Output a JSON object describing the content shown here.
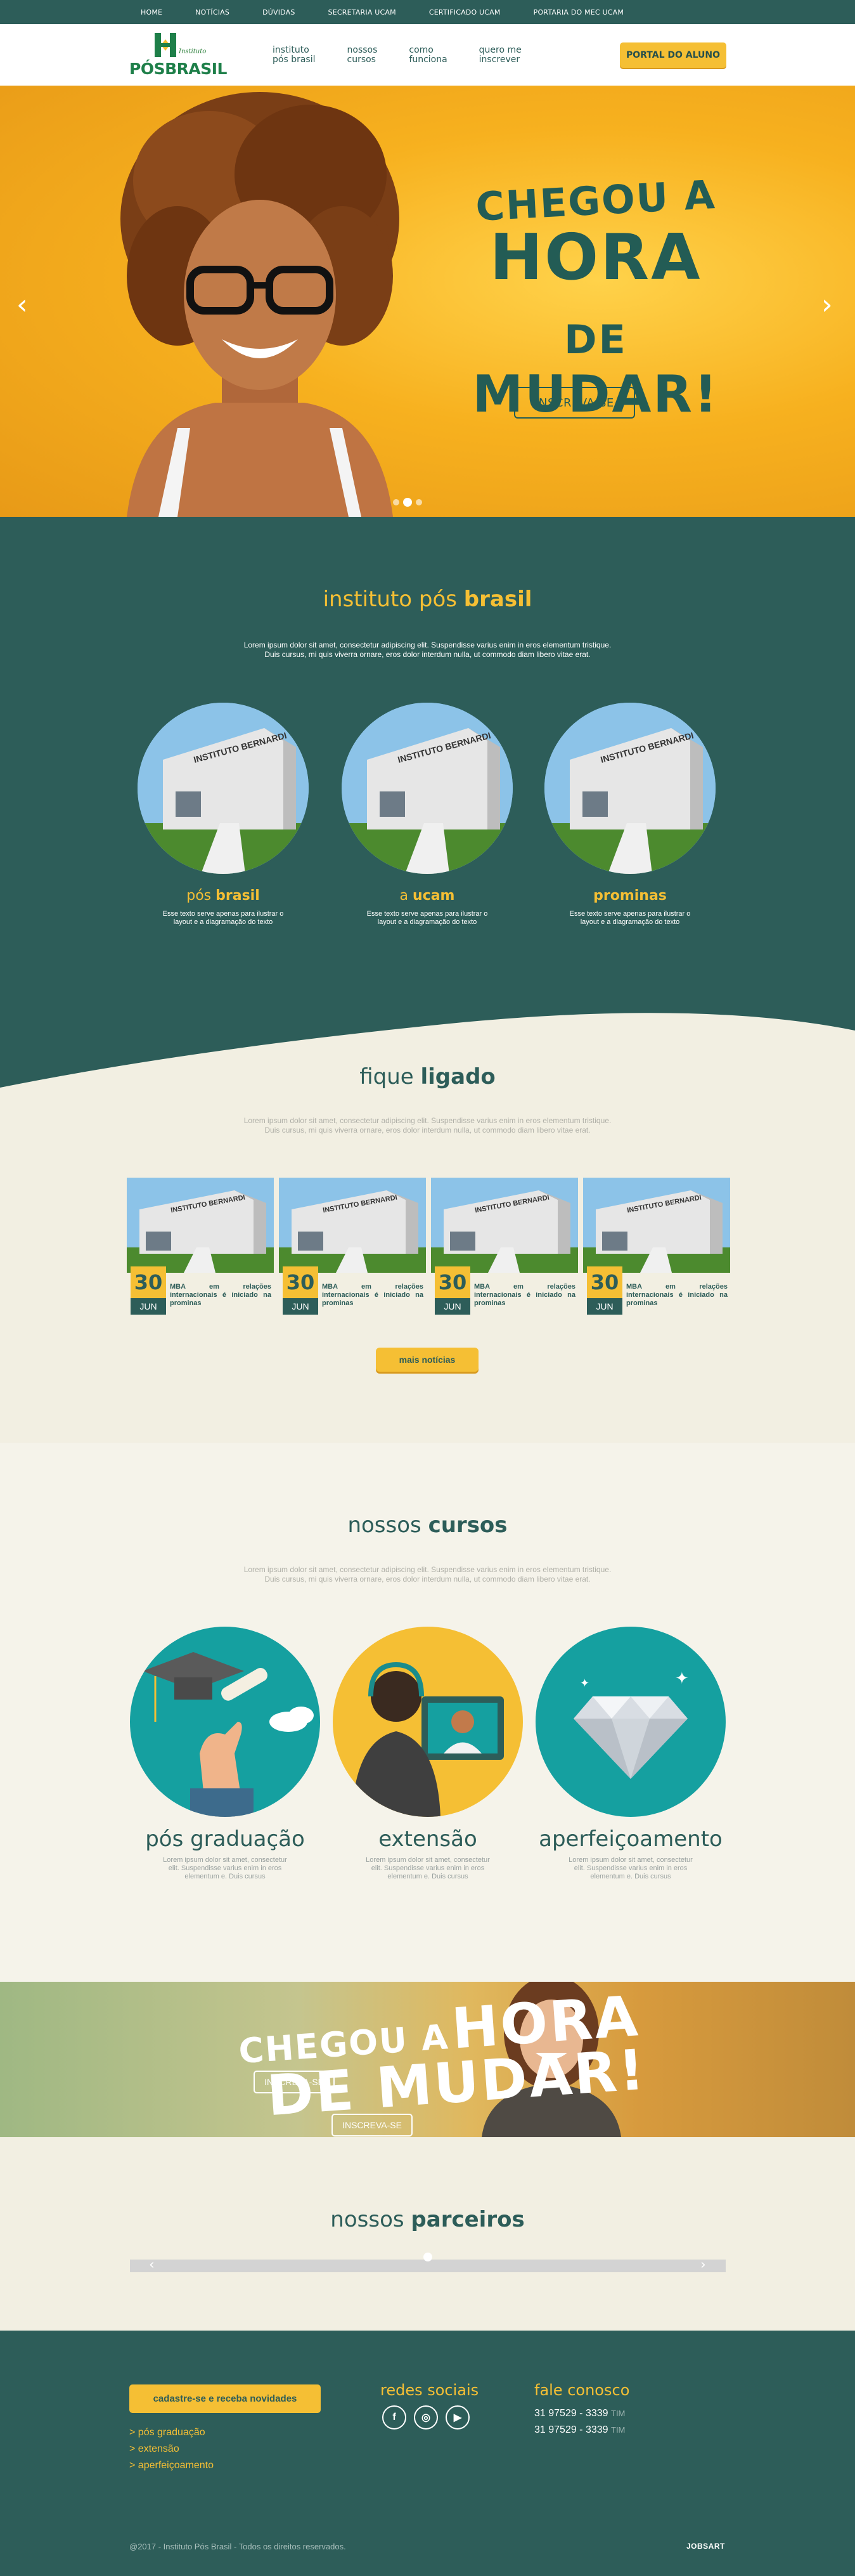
{
  "topnav": [
    "HOME",
    "NOTÍCIAS",
    "DÚVIDAS",
    "SECRETARIA UCAM",
    "CERTIFICADO UCAM",
    "PORTARIA DO MEC UCAM"
  ],
  "logo": {
    "small": "Instituto",
    "big_a": "PÓS",
    "big_b": "BRASIL"
  },
  "mainnav": [
    {
      "l1": "instituto",
      "l2": "pós brasil"
    },
    {
      "l1": "nossos",
      "l2": "cursos"
    },
    {
      "l1": "como",
      "l2": "funciona"
    },
    {
      "l1": "quero me",
      "l2": "inscrever"
    }
  ],
  "portal_button": "PORTAL DO ALUNO",
  "hero": {
    "line1": "CHEGOU A",
    "line2a": "HORA",
    "line2b": "DE",
    "line3": "MUDAR!",
    "button": "INSCREVA-SE",
    "prev": "‹",
    "next": "›"
  },
  "instituto": {
    "title_a": "instituto pós",
    "title_b": "brasil",
    "desc1": "Lorem ipsum dolor sit amet, consectetur adipiscing elit. Suspendisse varius enim in eros elementum tristique.",
    "desc2": "Duis cursus, mi quis viverra ornare, eros dolor interdum nulla, ut commodo diam libero vitae erat.",
    "items": [
      {
        "a": "pós",
        "b": "brasil",
        "text": "Esse texto serve apenas para ilustrar o layout e a diagramação do texto"
      },
      {
        "a": "a",
        "b": "ucam",
        "text": "Esse texto serve apenas para ilustrar o layout e a diagramação do texto"
      },
      {
        "a": "",
        "b": "prominas",
        "text": "Esse texto serve apenas para ilustrar o layout e a diagramação do texto"
      }
    ],
    "building_text": "INSTITUTO BERNARDI"
  },
  "fique": {
    "title_a": "fique",
    "title_b": "ligado",
    "desc1": "Lorem ipsum dolor sit amet, consectetur adipiscing elit. Suspendisse varius enim in eros elementum tristique.",
    "desc2": "Duis cursus, mi quis viverra ornare, eros dolor interdum nulla, ut commodo diam libero vitae erat.",
    "news": [
      {
        "day": "30",
        "month": "JUN",
        "text": "MBA em relações internacionais é iniciado na prominas"
      },
      {
        "day": "30",
        "month": "JUN",
        "text": "MBA em relações internacionais é iniciado na prominas"
      },
      {
        "day": "30",
        "month": "JUN",
        "text": "MBA em relações internacionais é iniciado na prominas"
      },
      {
        "day": "30",
        "month": "JUN",
        "text": "MBA em relações internacionais é iniciado na prominas"
      }
    ],
    "more_button": "mais notícias"
  },
  "cursos": {
    "title_a": "nossos",
    "title_b": "cursos",
    "desc1": "Lorem ipsum dolor sit amet, consectetur adipiscing elit. Suspendisse varius enim in eros elementum tristique.",
    "desc2": "Duis cursus, mi quis viverra ornare, eros dolor interdum nulla, ut commodo diam libero vitae erat.",
    "items": [
      {
        "title": "pós graduação",
        "text": "Lorem ipsum dolor sit amet, consectetur elit. Suspendisse varius enim in eros elementum e. Duis cursus"
      },
      {
        "title": "extensão",
        "text": "Lorem ipsum dolor sit amet, consectetur elit. Suspendisse varius enim in eros elementum e. Duis cursus"
      },
      {
        "title": "aperfeiçoamento",
        "text": "Lorem ipsum dolor sit amet, consectetur elit. Suspendisse varius enim in eros elementum e. Duis cursus"
      }
    ]
  },
  "banner2": {
    "a": "CHEGOU A",
    "b": "HORA",
    "c": "DE MUDAR!",
    "button1": "INSCREVA-SE",
    "button2": "INSCREVA-SE"
  },
  "parceiros": {
    "title_a": "nossos",
    "title_b": "parceiros",
    "prev": "‹",
    "next": "›"
  },
  "footer": {
    "signup_button": "cadastre-se e receba novidades",
    "links": [
      "> pós graduação",
      "> extensão",
      "> aperfeiçoamento"
    ],
    "social_title": "redes sociais",
    "social": [
      "f",
      "◎",
      "▶"
    ],
    "contact_title": "fale conosco",
    "phones": [
      {
        "num": "31 97529 - 3339",
        "op": "TIM"
      },
      {
        "num": "31 97529 - 3339",
        "op": "TIM"
      }
    ],
    "copyright": "@2017 - Instituto Pós Brasil - Todos os direitos reservados.",
    "credit": "JOBSART"
  },
  "colors": {
    "teal": "#2d5d59",
    "yellow": "#f5bf34",
    "cream": "#f2efe2"
  }
}
